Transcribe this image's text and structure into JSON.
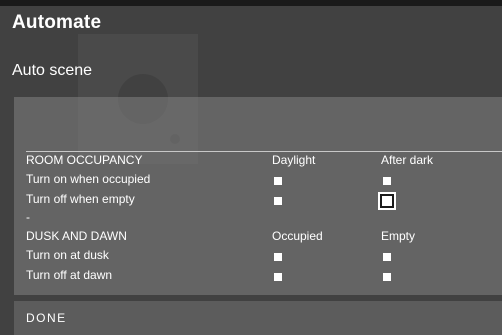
{
  "app": {
    "title": "Automate"
  },
  "page": {
    "title": "Auto scene"
  },
  "room_occupancy": {
    "heading": "ROOM OCCUPANCY",
    "columns": [
      "Daylight",
      "After dark"
    ],
    "rows": [
      {
        "label": "Turn on when occupied",
        "checked": [
          false,
          false
        ]
      },
      {
        "label": "Turn off when empty",
        "checked": [
          false,
          false
        ]
      }
    ]
  },
  "separator": "-",
  "dusk_and_dawn": {
    "heading": "DUSK AND DAWN",
    "columns": [
      "Occupied",
      "Empty"
    ],
    "rows": [
      {
        "label": "Turn on at dusk",
        "checked": [
          false,
          false
        ]
      },
      {
        "label": "Turn off at dawn",
        "checked": [
          false,
          false
        ]
      }
    ]
  },
  "footer": {
    "done_label": "DONE"
  },
  "colors": {
    "background": "#414141",
    "panel": "#7f7f7f",
    "text": "#ffffff",
    "divider": "#c8c8c8"
  }
}
